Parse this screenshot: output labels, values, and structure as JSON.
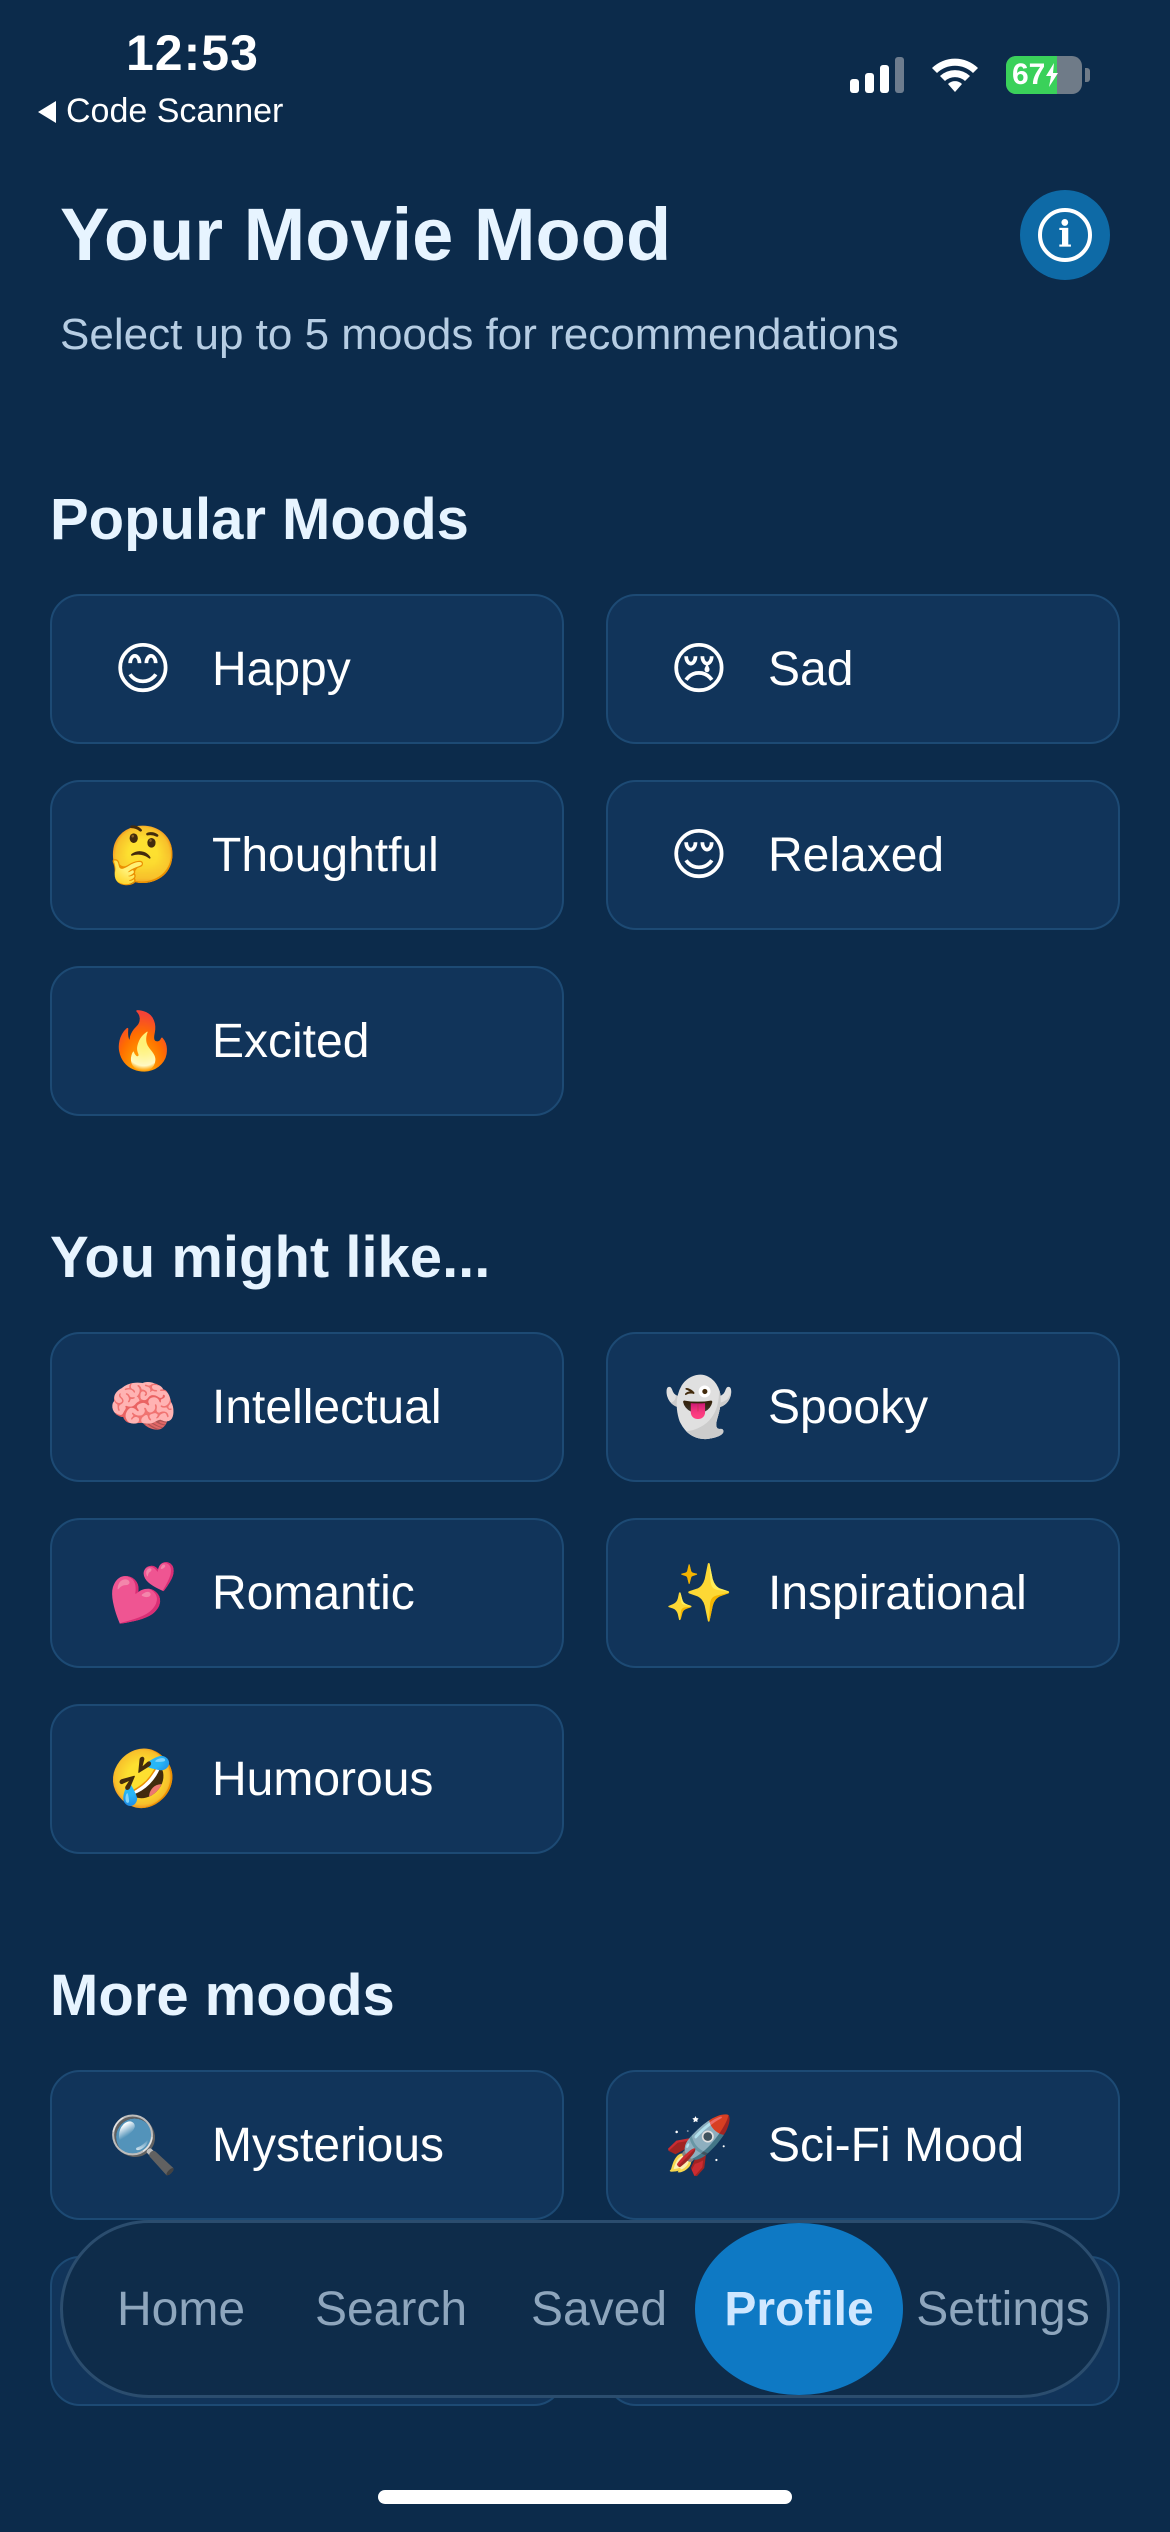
{
  "status_bar": {
    "time": "12:53",
    "back_app": "Code Scanner",
    "battery": "67",
    "battery_level": 0.67,
    "icons": [
      "signal-icon",
      "wifi-icon",
      "battery-charging-icon"
    ]
  },
  "header": {
    "title": "Your Movie Mood",
    "subtitle": "Select up to 5 moods for recommendations",
    "info_icon": "info-icon"
  },
  "sections": {
    "popular": {
      "title": "Popular Moods",
      "items": [
        {
          "emoji": "😊",
          "label": "Happy"
        },
        {
          "emoji": "😢",
          "label": "Sad"
        },
        {
          "emoji": "🤔",
          "label": "Thoughtful"
        },
        {
          "emoji": "😌",
          "label": "Relaxed"
        },
        {
          "emoji": "🔥",
          "label": "Excited"
        }
      ]
    },
    "suggested": {
      "title": "You might like...",
      "items": [
        {
          "emoji": "🧠",
          "label": "Intellectual"
        },
        {
          "emoji": "👻",
          "label": "Spooky"
        },
        {
          "emoji": "💕",
          "label": "Romantic"
        },
        {
          "emoji": "✨",
          "label": "Inspirational"
        },
        {
          "emoji": "🤣",
          "label": "Humorous"
        }
      ]
    },
    "more": {
      "title": "More moods",
      "items": [
        {
          "emoji": "🔍",
          "label": "Mysterious"
        },
        {
          "emoji": "🚀",
          "label": "Sci-Fi Mood"
        }
      ]
    }
  },
  "tab_bar": {
    "tabs": [
      {
        "label": "Home"
      },
      {
        "label": "Search"
      },
      {
        "label": "Saved"
      },
      {
        "label": "Profile",
        "active": true
      },
      {
        "label": "Settings"
      }
    ]
  },
  "colors": {
    "background": "#0c2b4b",
    "chip": "#11345a",
    "accent": "#0e79c4",
    "battery": "#3ad15a"
  }
}
